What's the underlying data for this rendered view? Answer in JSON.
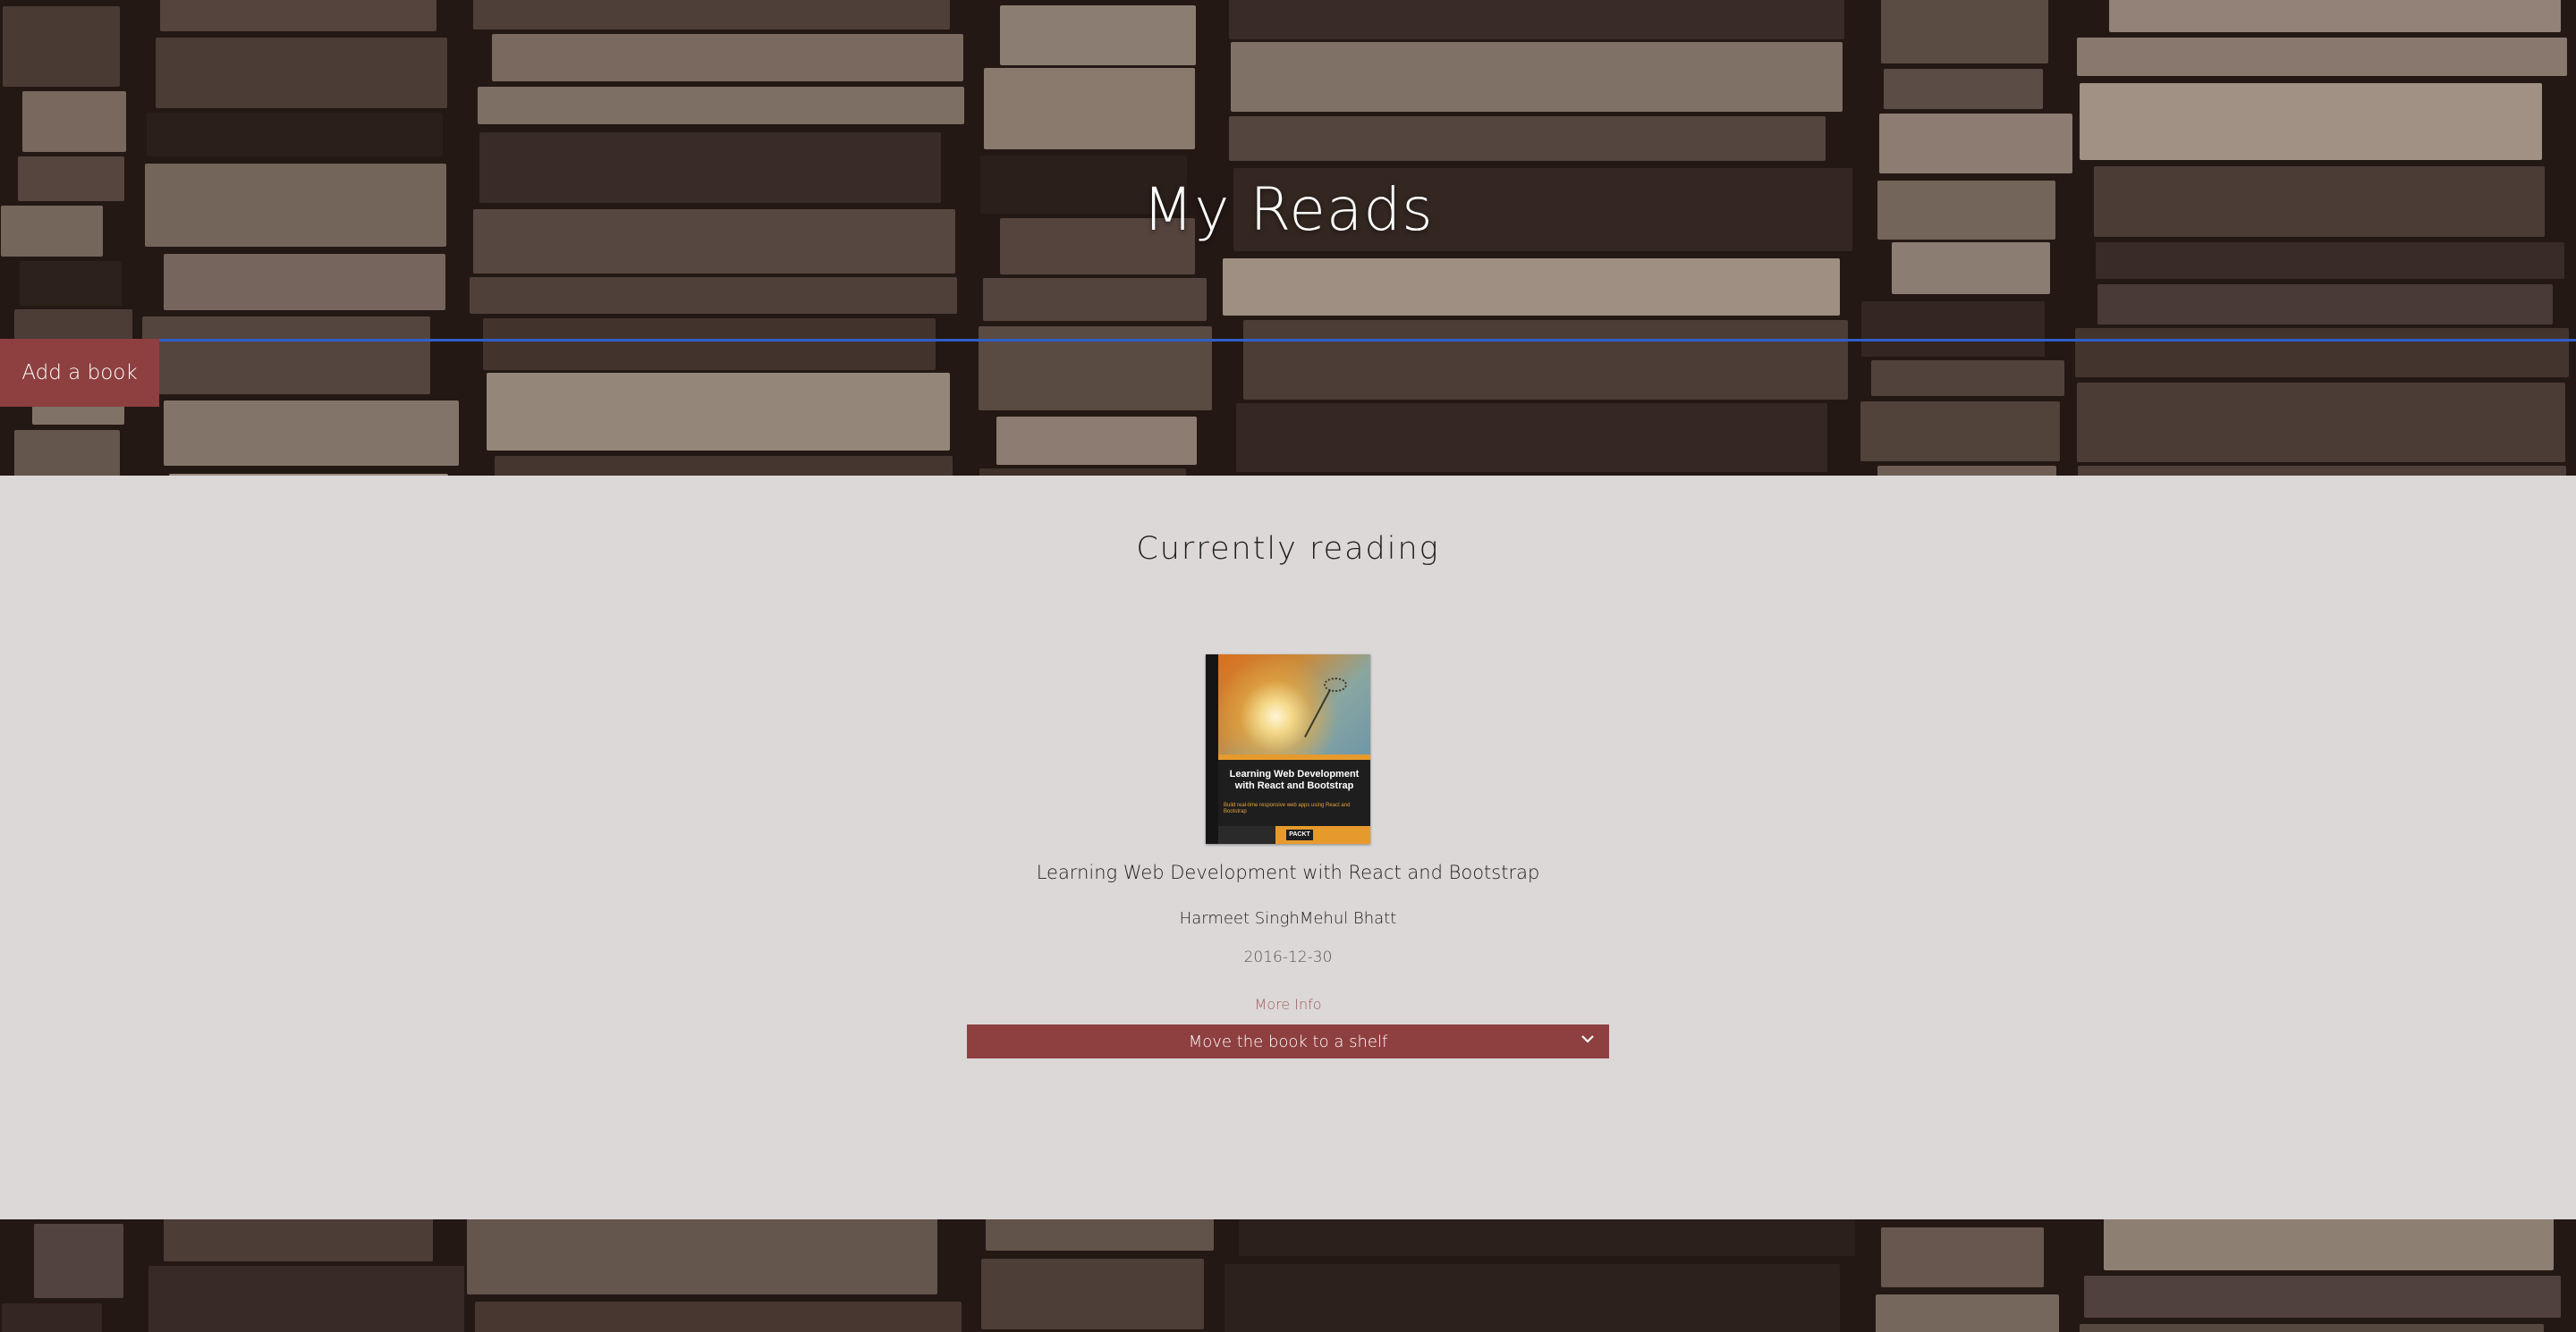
{
  "app": {
    "title": "My Reads"
  },
  "header": {
    "add_book_label": "Add a book"
  },
  "shelf": {
    "title": "Currently reading",
    "books": [
      {
        "title": "Learning Web Development with React and Bootstrap",
        "authors": "Harmeet SinghMehul Bhatt",
        "published": "2016-12-30",
        "more_info_label": "More Info",
        "move_select_label": "Move the book to a shelf",
        "cover": {
          "title_line_1": "Learning Web Development",
          "title_line_2": "with React and Bootstrap",
          "subtitle": "Build real-time responsive web apps using React and Bootstrap",
          "publisher": "PACKT"
        }
      }
    ]
  },
  "colors": {
    "accent": "#8e3f3f",
    "divider": "#2f5fc9",
    "shelf_background": "#dcd8d8",
    "hero_background": "#241814",
    "link": "#a35a5a"
  },
  "icons": {
    "select_arrow": "chevron-down-icon"
  }
}
